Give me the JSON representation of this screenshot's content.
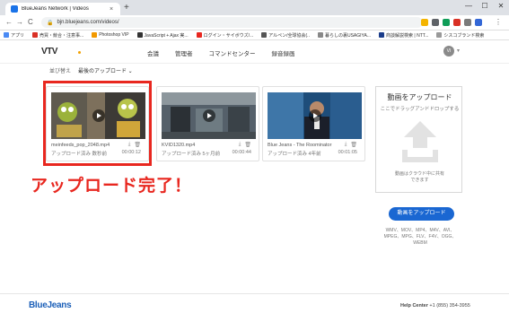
{
  "browser": {
    "tab_title": "BlueJeans Network | Videos",
    "tab_close": "×",
    "new_tab": "+",
    "win_minimize": "—",
    "win_maximize": "☐",
    "win_close": "✕",
    "nav_back": "←",
    "nav_forward": "→",
    "nav_reload": "C",
    "url": "bjn.bluejeans.com/videos/",
    "menu_icon": "⋮",
    "bookmarks": [
      {
        "label": "アプリ",
        "color": "#4a8af4"
      },
      {
        "label": "売買・競合・注意事...",
        "color": "#d93025"
      },
      {
        "label": "Photoshop VIP",
        "color": "#f29900"
      },
      {
        "label": "JavaScript + Ajax 実...",
        "color": "#333333"
      },
      {
        "label": "ログイン・サイボウズ/...",
        "color": "#e8271f"
      },
      {
        "label": "アルペン/全球協会(..",
        "color": "#555555"
      },
      {
        "label": "暮らしの裏USAGIYA...",
        "color": "#888888"
      },
      {
        "label": "商談解説検索 | NTT...",
        "color": "#1a3c8a"
      },
      {
        "label": "シスコブランド検索",
        "color": "#999999"
      }
    ]
  },
  "app": {
    "logo": "VTV",
    "nav": [
      "会議",
      "管理者",
      "コマンドセンター",
      "録音録画"
    ],
    "avatar_initials": "VI",
    "avatar_caret": "▾",
    "sort_label": "並び替え",
    "sort_value": "最後のアップロード ⌄"
  },
  "videos": [
    {
      "name": "meinfeeds_pop_2048.mp4",
      "uploaded": "アップロード済み 数秒前",
      "duration": "00:00:12",
      "download_icon": "⤓",
      "delete_icon": "🗑"
    },
    {
      "name": "KVID1320.mp4",
      "uploaded": "アップロード済み 5ヶ月前",
      "duration": "00:00:44",
      "download_icon": "⤓",
      "delete_icon": "🗑"
    },
    {
      "name": "Blue Jeans - The Roominator",
      "uploaded": "アップロード済み 4年前",
      "duration": "00:01:05",
      "download_icon": "⤓",
      "delete_icon": "🗑"
    }
  ],
  "annotation": "アップロード完了！",
  "upload_panel": {
    "title": "動画をアップロード",
    "subtitle": "ここでドラッグアンドドロップする",
    "cloud_line1": "動画はクラウド中に共有",
    "cloud_line2": "できます",
    "button": "動画をアップロード",
    "formats_line1": "WMV、MOV、MP4、M4V、AVI、",
    "formats_line2": "MPEG、MPG、FLV、F4V、OGG、",
    "formats_line3": "WEBM"
  },
  "footer": {
    "logo": "BlueJeans",
    "help_label": "Help Center",
    "help_phone": "+1 (855) 354-3955"
  }
}
